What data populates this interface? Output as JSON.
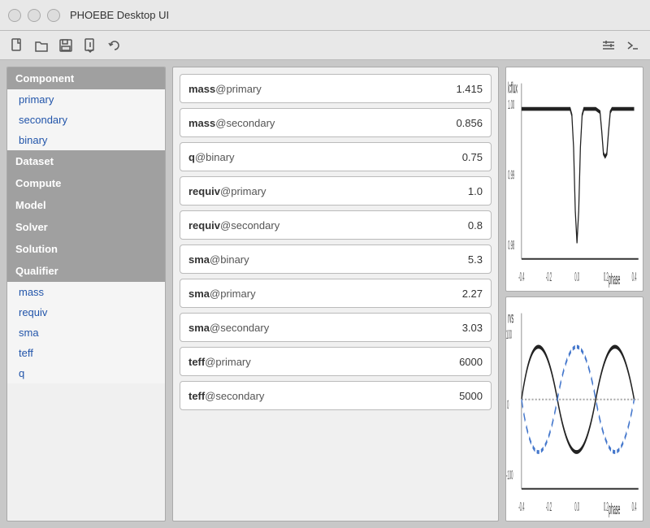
{
  "titleBar": {
    "title": "PHOEBE Desktop UI"
  },
  "toolbar": {
    "icons": [
      "new",
      "open",
      "save",
      "export",
      "undo",
      "settings",
      "terminal"
    ]
  },
  "sidebar": {
    "sections": [
      {
        "label": "Component",
        "items": [
          {
            "label": "primary",
            "id": "primary"
          },
          {
            "label": "secondary",
            "id": "secondary"
          },
          {
            "label": "binary",
            "id": "binary"
          }
        ]
      },
      {
        "label": "Dataset",
        "items": []
      },
      {
        "label": "Compute",
        "items": []
      },
      {
        "label": "Model",
        "items": []
      },
      {
        "label": "Solver",
        "items": []
      },
      {
        "label": "Solution",
        "items": []
      },
      {
        "label": "Qualifier",
        "items": [
          {
            "label": "mass",
            "id": "mass"
          },
          {
            "label": "requiv",
            "id": "requiv"
          },
          {
            "label": "sma",
            "id": "sma"
          },
          {
            "label": "teff",
            "id": "teff"
          },
          {
            "label": "q",
            "id": "q"
          }
        ]
      }
    ]
  },
  "params": [
    {
      "qualifier": "mass",
      "component": "@primary",
      "value": "1.415"
    },
    {
      "qualifier": "mass",
      "component": "@secondary",
      "value": "0.856"
    },
    {
      "qualifier": "q",
      "component": "@binary",
      "value": "0.75"
    },
    {
      "qualifier": "requiv",
      "component": "@primary",
      "value": "1.0"
    },
    {
      "qualifier": "requiv",
      "component": "@secondary",
      "value": "0.8"
    },
    {
      "qualifier": "sma",
      "component": "@binary",
      "value": "5.3"
    },
    {
      "qualifier": "sma",
      "component": "@primary",
      "value": "2.27"
    },
    {
      "qualifier": "sma",
      "component": "@secondary",
      "value": "3.03"
    },
    {
      "qualifier": "teff",
      "component": "@primary",
      "value": "6000"
    },
    {
      "qualifier": "teff",
      "component": "@secondary",
      "value": "5000"
    }
  ],
  "charts": {
    "top": {
      "label": "light curve chart"
    },
    "bottom": {
      "label": "rv curve chart"
    }
  }
}
